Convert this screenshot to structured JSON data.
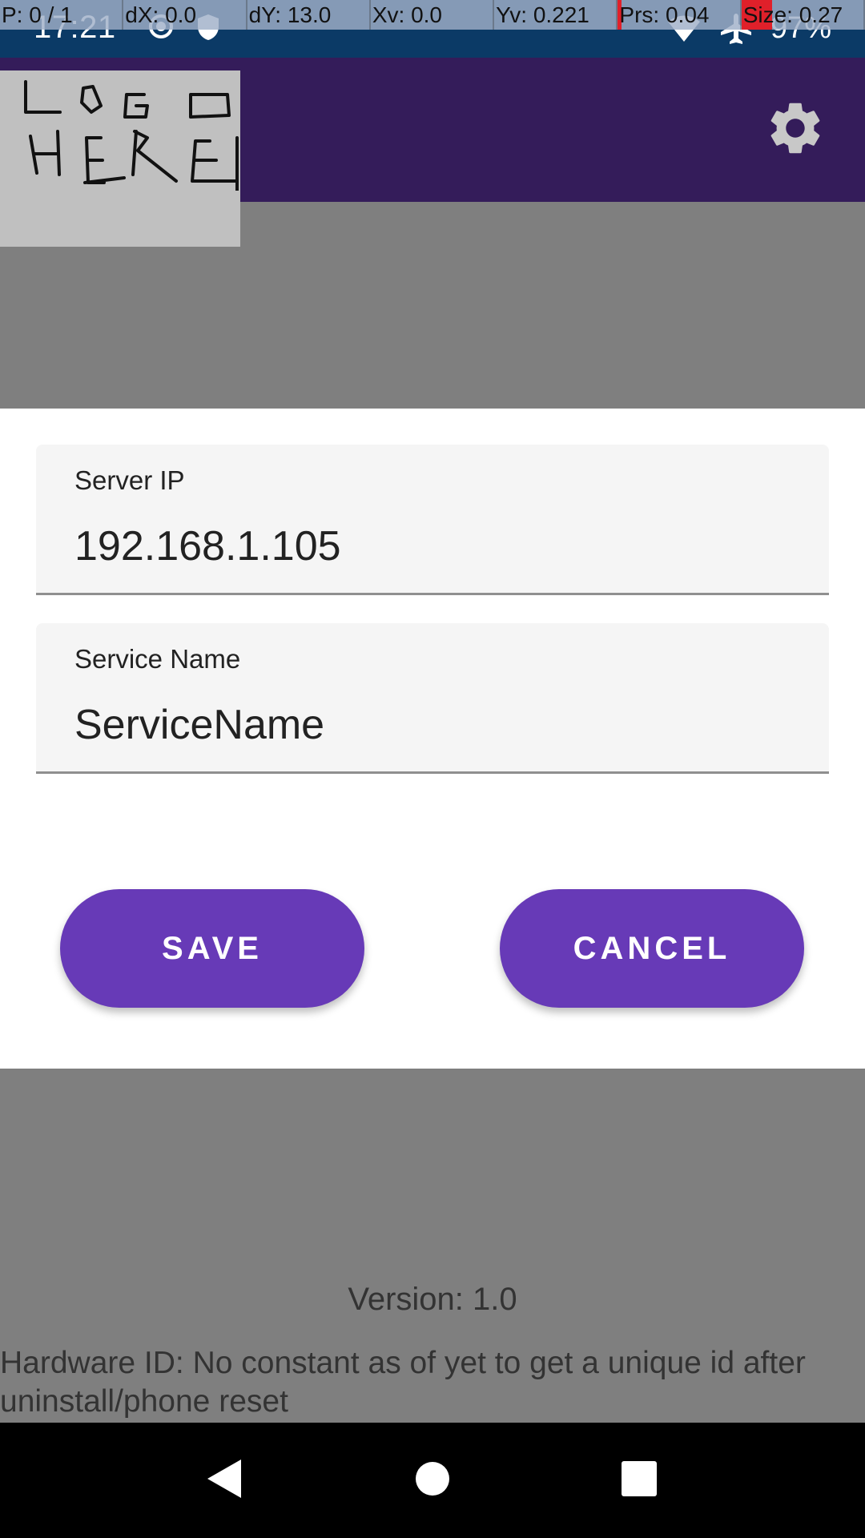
{
  "status_bar": {
    "time": "17:21",
    "battery": "97%",
    "icons": [
      "location-target-icon",
      "shield-icon",
      "wifi-icon",
      "airplane-icon"
    ]
  },
  "debug_overlay": {
    "pointer": "P: 0 / 1",
    "dx": "dX: 0.0",
    "dy": "dY: 13.0",
    "xv": "Xv: 0.0",
    "yv": "Yv: 0.221",
    "prs": "Prs: 0.04",
    "size": "Size: 0.27"
  },
  "app_bar": {
    "logo_text": [
      "LOGO",
      "HERE"
    ],
    "settings_icon": "gear-icon",
    "color": "#341c5a"
  },
  "form": {
    "server_ip": {
      "label": "Server IP",
      "value": "192.168.1.105"
    },
    "service_name": {
      "label": "Service Name",
      "value": "ServiceName"
    },
    "save_label": "SAVE",
    "cancel_label": "CANCEL",
    "button_color": "#673ab7"
  },
  "footer": {
    "version": "Version: 1.0",
    "hardware_id_line1": "Hardware ID: No constant as of yet to get a unique id after",
    "hardware_id_line2": "uninstall/phone reset"
  },
  "nav_bar": {
    "icons": [
      "back-icon",
      "home-icon",
      "recents-icon"
    ]
  }
}
